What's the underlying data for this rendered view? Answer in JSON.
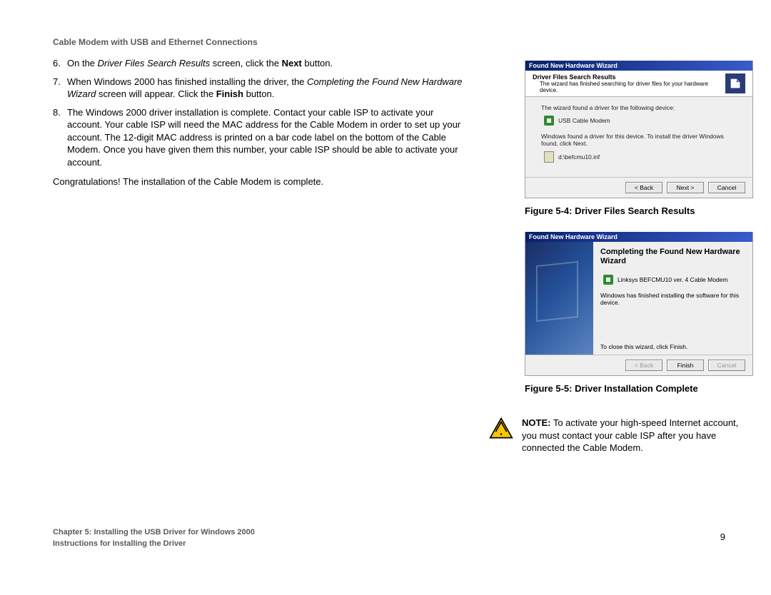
{
  "header": {
    "title": "Cable Modem with USB and Ethernet Connections"
  },
  "steps": [
    {
      "num": "6.",
      "html": "On the <i>Driver Files Search Results</i> screen, click the <b>Next</b> button."
    },
    {
      "num": "7.",
      "html": "When Windows 2000 has finished installing the driver, the <i>Completing the Found New Hardware Wizard</i> screen will appear. Click the <b>Finish</b> button."
    },
    {
      "num": "8.",
      "html": "The Windows 2000 driver installation is complete. Contact your cable ISP to activate your account. Your cable ISP will need the MAC address for the Cable Modem in order to set up your account. The 12-digit MAC address is printed on a bar code label on the bottom of the Cable Modem. Once you have given them this number, your cable ISP should be able to activate your account."
    }
  ],
  "congrats": "Congratulations! The installation of the Cable Modem is complete.",
  "wizard1": {
    "titlebar": "Found New Hardware Wizard",
    "header_title": "Driver Files Search Results",
    "header_sub": "The wizard has finished searching for driver files for your hardware device.",
    "body1": "The wizard found a driver for the following device:",
    "device": "USB Cable Modem",
    "body2": "Windows found a driver for this device. To install the driver Windows found, click Next.",
    "file": "d:\\befcmu10.inf",
    "btn_back": "< Back",
    "btn_next": "Next >",
    "btn_cancel": "Cancel"
  },
  "caption1": "Figure 5-4: Driver Files Search Results",
  "wizard2": {
    "titlebar": "Found New Hardware Wizard",
    "title": "Completing the Found New Hardware Wizard",
    "device": "Linksys BEFCMU10 ver. 4  Cable Modem",
    "body": "Windows has finished installing the software for this device.",
    "bottom": "To close this wizard, click Finish.",
    "btn_back": "< Back",
    "btn_finish": "Finish",
    "btn_cancel": "Cancel"
  },
  "caption2": "Figure 5-5: Driver Installation Complete",
  "note": {
    "label": "NOTE:",
    "text": "To activate your high-speed Internet account, you must contact your cable ISP after you have connected the Cable Modem."
  },
  "footer": {
    "chapter": "Chapter 5: Installing the USB Driver for Windows 2000",
    "section": "Instructions for Installing the Driver",
    "page": "9"
  }
}
